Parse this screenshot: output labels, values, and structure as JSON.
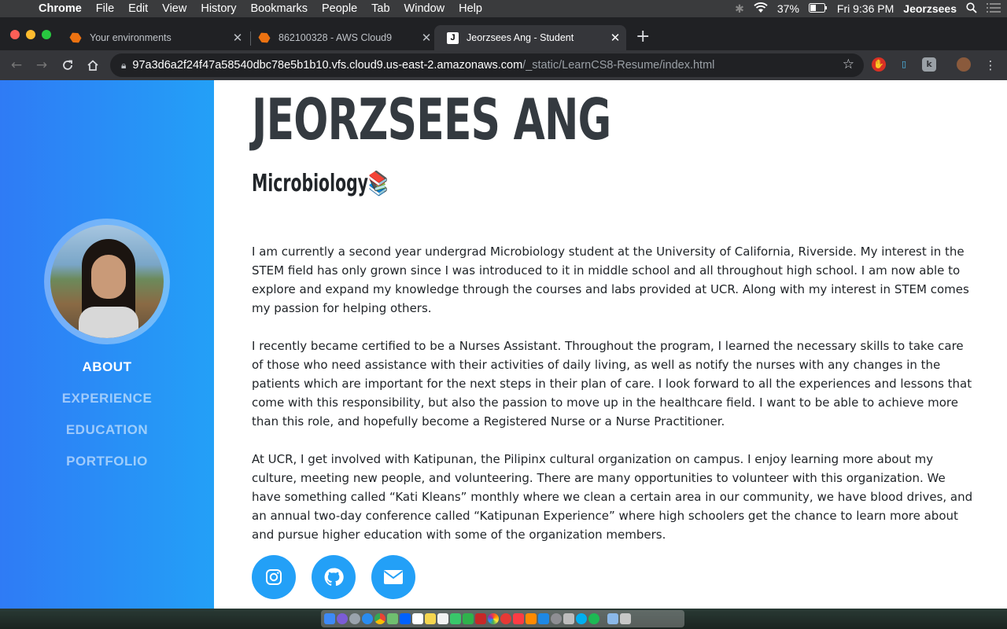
{
  "menubar": {
    "app": "Chrome",
    "items": [
      "File",
      "Edit",
      "View",
      "History",
      "Bookmarks",
      "People",
      "Tab",
      "Window",
      "Help"
    ],
    "battery": "37%",
    "clock": "Fri 9:36 PM",
    "user": "Jeorzsees"
  },
  "tabs": [
    {
      "title": "Your environments",
      "active": false
    },
    {
      "title": "862100328 - AWS Cloud9",
      "active": false
    },
    {
      "title": "Jeorzsees Ang - Student",
      "active": true
    }
  ],
  "address": {
    "host": "97a3d6a2f24f47a58540dbc78e5b1b10.vfs.cloud9.us-east-2.amazonaws.com",
    "path": "/_static/LearnCS8-Resume/index.html"
  },
  "sidebar": {
    "nav": [
      {
        "label": "ABOUT",
        "active": true
      },
      {
        "label": "EXPERIENCE",
        "active": false
      },
      {
        "label": "EDUCATION",
        "active": false
      },
      {
        "label": "PORTFOLIO",
        "active": false
      }
    ]
  },
  "main": {
    "name": "JEORZSEES ANG",
    "subtitle": "Microbiology📚",
    "paragraphs": [
      "I am currently a second year undergrad Microbiology student at the University of California, Riverside. My interest in the STEM field has only grown since I was introduced to it in middle school and all throughout high school. I am now able to explore and expand my knowledge through the courses and labs provided at UCR. Along with my interest in STEM comes my passion for helping others.",
      "I recently became certified to be a Nurses Assistant. Throughout the program, I learned the necessary skills to take care of those who need assistance with their activities of daily living, as well as notify the nurses with any changes in the patients which are important for the next steps in their plan of care. I look forward to all the experiences and lessons that come with this responsibility, but also the passion to move up in the healthcare field. I want to be able to achieve more than this role, and hopefully become a Registered Nurse or a Nurse Practitioner.",
      "At UCR, I get involved with Katipunan, the Pilipinx cultural organization on campus. I enjoy learning more about my culture, meeting new people, and volunteering. There are many opportunities to volunteer with this organization. We have something called “Kati Kleans” monthly where we clean a certain area in our community, we have blood drives, and an annual two-day conference called “Katipunan Experience” where high schoolers get the chance to learn more about and pursue higher education with some of the organization members."
    ],
    "social": [
      "instagram-icon",
      "github-icon",
      "envelope-icon"
    ]
  },
  "colors": {
    "sidebar_start": "#2f7bf5",
    "sidebar_end": "#23a0f7",
    "heading": "#343a40",
    "social_bg": "#23a0f7"
  }
}
